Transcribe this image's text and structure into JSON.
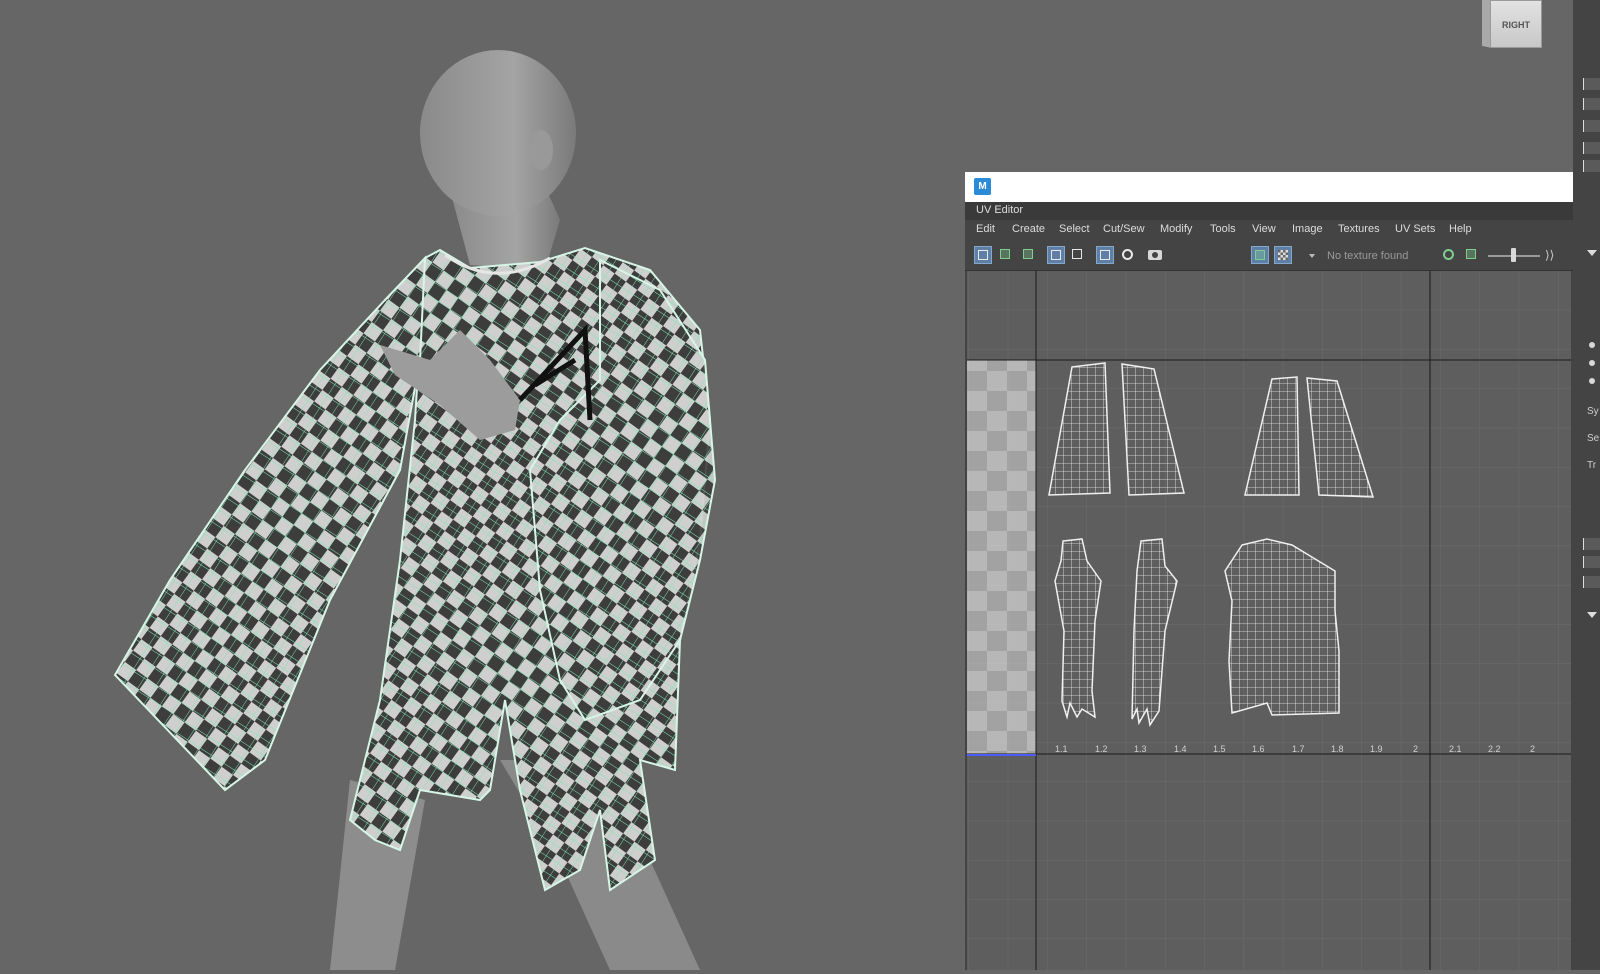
{
  "viewport": {
    "viewcube_label": "RIGHT"
  },
  "side_panel": {
    "labels": [
      "Sy",
      "Se",
      "Tr"
    ]
  },
  "uv_editor": {
    "window_icon": "M",
    "panel_title": "UV Editor",
    "menu": [
      "Edit",
      "Create",
      "Select",
      "Cut/Sew",
      "Modify",
      "Tools",
      "View",
      "Image",
      "Textures",
      "UV Sets",
      "Help"
    ],
    "texture_placeholder": "No texture found",
    "tick_labels": [
      "1.1",
      "1.2",
      "1.3",
      "1.4",
      "1.5",
      "1.6",
      "1.7",
      "1.8",
      "1.9",
      "2",
      "2.1",
      "2.2",
      "2"
    ],
    "colors": {
      "wire": "#7fe6b3",
      "grid_bg": "#5e5e5e",
      "accent": "#5f7fa6"
    }
  }
}
